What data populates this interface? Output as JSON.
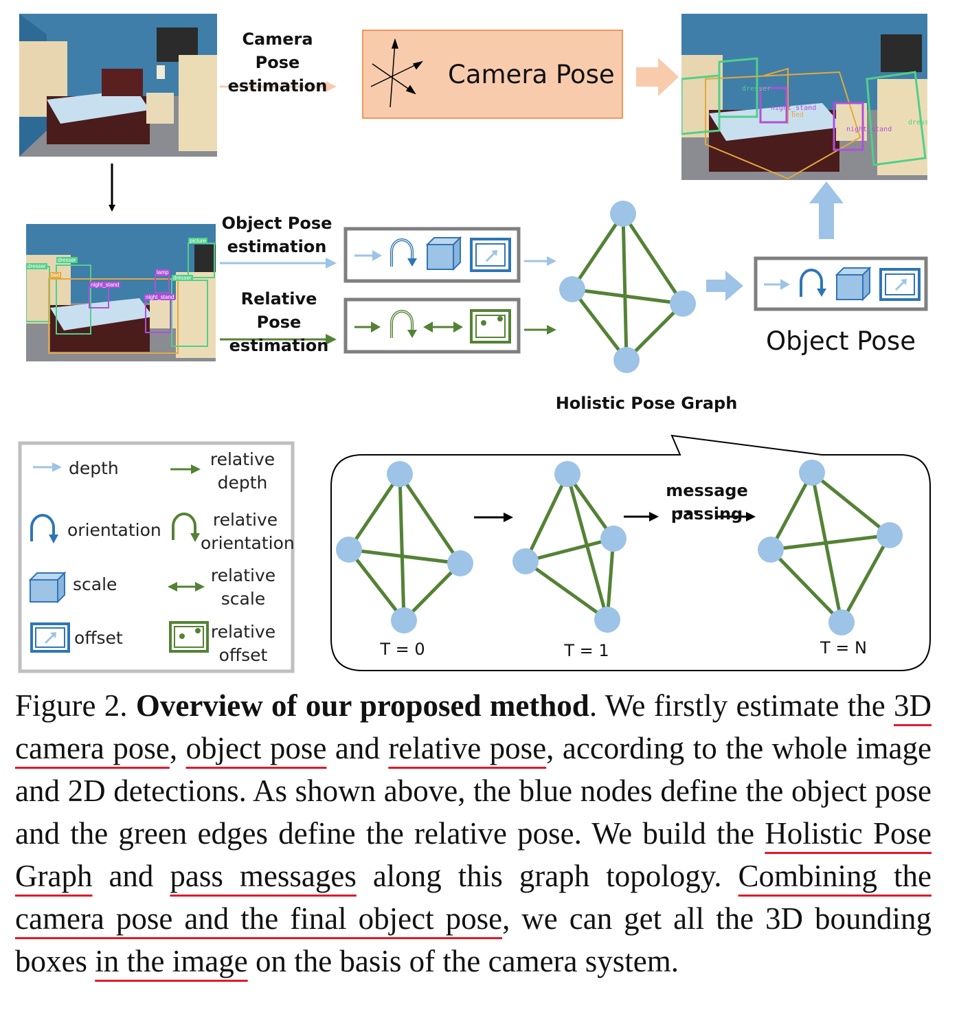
{
  "labels": {
    "camera_pose_est": "Camera Pose estimation",
    "object_pose_est": "Object Pose estimation",
    "relative_pose_est": "Relative Pose estimation",
    "camera_pose": "Camera Pose",
    "object_pose": "Object Pose",
    "holistic_pose_graph": "Holistic Pose Graph",
    "message_passing": "message passing",
    "ellipsis": "···",
    "t0": "T = 0",
    "t1": "T = 1",
    "tn": "T = N"
  },
  "legend": {
    "depth": "depth",
    "relative_depth": "relative depth",
    "orientation": "orientation",
    "relative_orientation": "relative orientation",
    "scale": "scale",
    "relative_scale": "relative scale",
    "offset": "offset",
    "relative_offset": "relative offset"
  },
  "detections": {
    "dresser": "dresser",
    "bed": "bed",
    "night_stand": "night_stand",
    "lamp": "lamp",
    "picture": "picture"
  },
  "caption": {
    "figure_label": "Figure 2.",
    "title": "Overview of our proposed method",
    "p1": ". We firstly estimate the ",
    "u1": "3D camera pose",
    "p2": ", ",
    "u2": "object pose",
    "p3": " and ",
    "u3": "relative pose",
    "p4": ", according to the whole image and 2D detections. As shown above, the blue nodes define the object pose and the green edges define the relative pose. We build the ",
    "u4": "Holistic Pose Graph",
    "p5": " and ",
    "u5": "pass messages",
    "p6": " along this graph topology. ",
    "u6": "Combining the camera pose and the final object pose",
    "p7": ", we can get all the 3D bounding boxes ",
    "u7": "in the image",
    "p8": " on the basis of the camera system."
  },
  "colors": {
    "node_blue": "#9dc3e6",
    "edge_green": "#548235",
    "depth_arrow": "#9dc3e6",
    "icon_blue": "#2e75b6",
    "camera_box_fill": "#f8cbad",
    "camera_box_border": "#ed7d31",
    "peach_arrow": "#f8cbad",
    "frame_gray": "#7f7f7f",
    "underline_red": "#e0192a"
  }
}
